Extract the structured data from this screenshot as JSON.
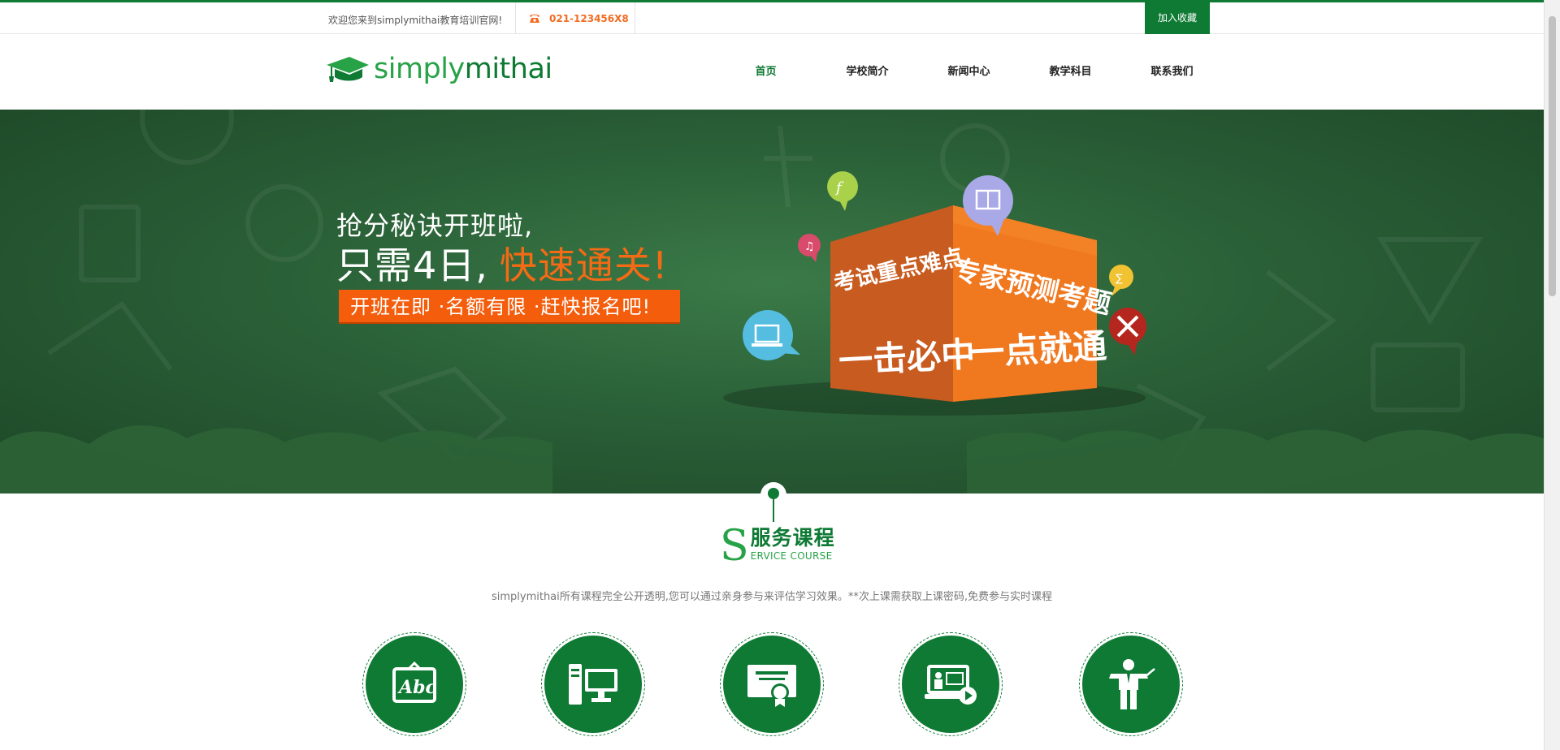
{
  "topbar": {
    "welcome": "欢迎您来到simplymithai教育培训官网!",
    "phone": "021-123456X8",
    "favorite_label": "加入收藏"
  },
  "logo": {
    "part1": "simply",
    "part2": "mithai"
  },
  "nav": {
    "items": [
      {
        "label": "首页",
        "active": true
      },
      {
        "label": "学校简介",
        "active": false
      },
      {
        "label": "新闻中心",
        "active": false
      },
      {
        "label": "教学科目",
        "active": false
      },
      {
        "label": "联系我们",
        "active": false
      }
    ]
  },
  "banner": {
    "slogan_line1": "抢分秘诀开班啦,",
    "slogan_line2_white": "只需4日,",
    "slogan_line2_orange": "快速通关!",
    "tag": "开班在即 ·名额有限 ·赶快报名吧!",
    "cube_left_top": "考试重点难点",
    "cube_left_bottom": "一击必中",
    "cube_right_top": "专家预测考题",
    "cube_right_bottom": "一点就通"
  },
  "section": {
    "letter": "S",
    "title_cn": "服务课程",
    "title_en": "ERVICE COURSE",
    "description": "simplymithai所有课程完全公开透明,您可以通过亲身参与来评估学习效果。**次上课需获取上课密码,免费参与实时课程"
  },
  "courses": [
    {
      "icon": "abc-board-icon"
    },
    {
      "icon": "desktop-computer-icon"
    },
    {
      "icon": "certificate-icon"
    },
    {
      "icon": "online-lesson-icon"
    },
    {
      "icon": "teacher-icon"
    }
  ],
  "colors": {
    "brand_green": "#0e7a34",
    "light_green": "#28a247",
    "accent_orange": "#f35d0c"
  }
}
